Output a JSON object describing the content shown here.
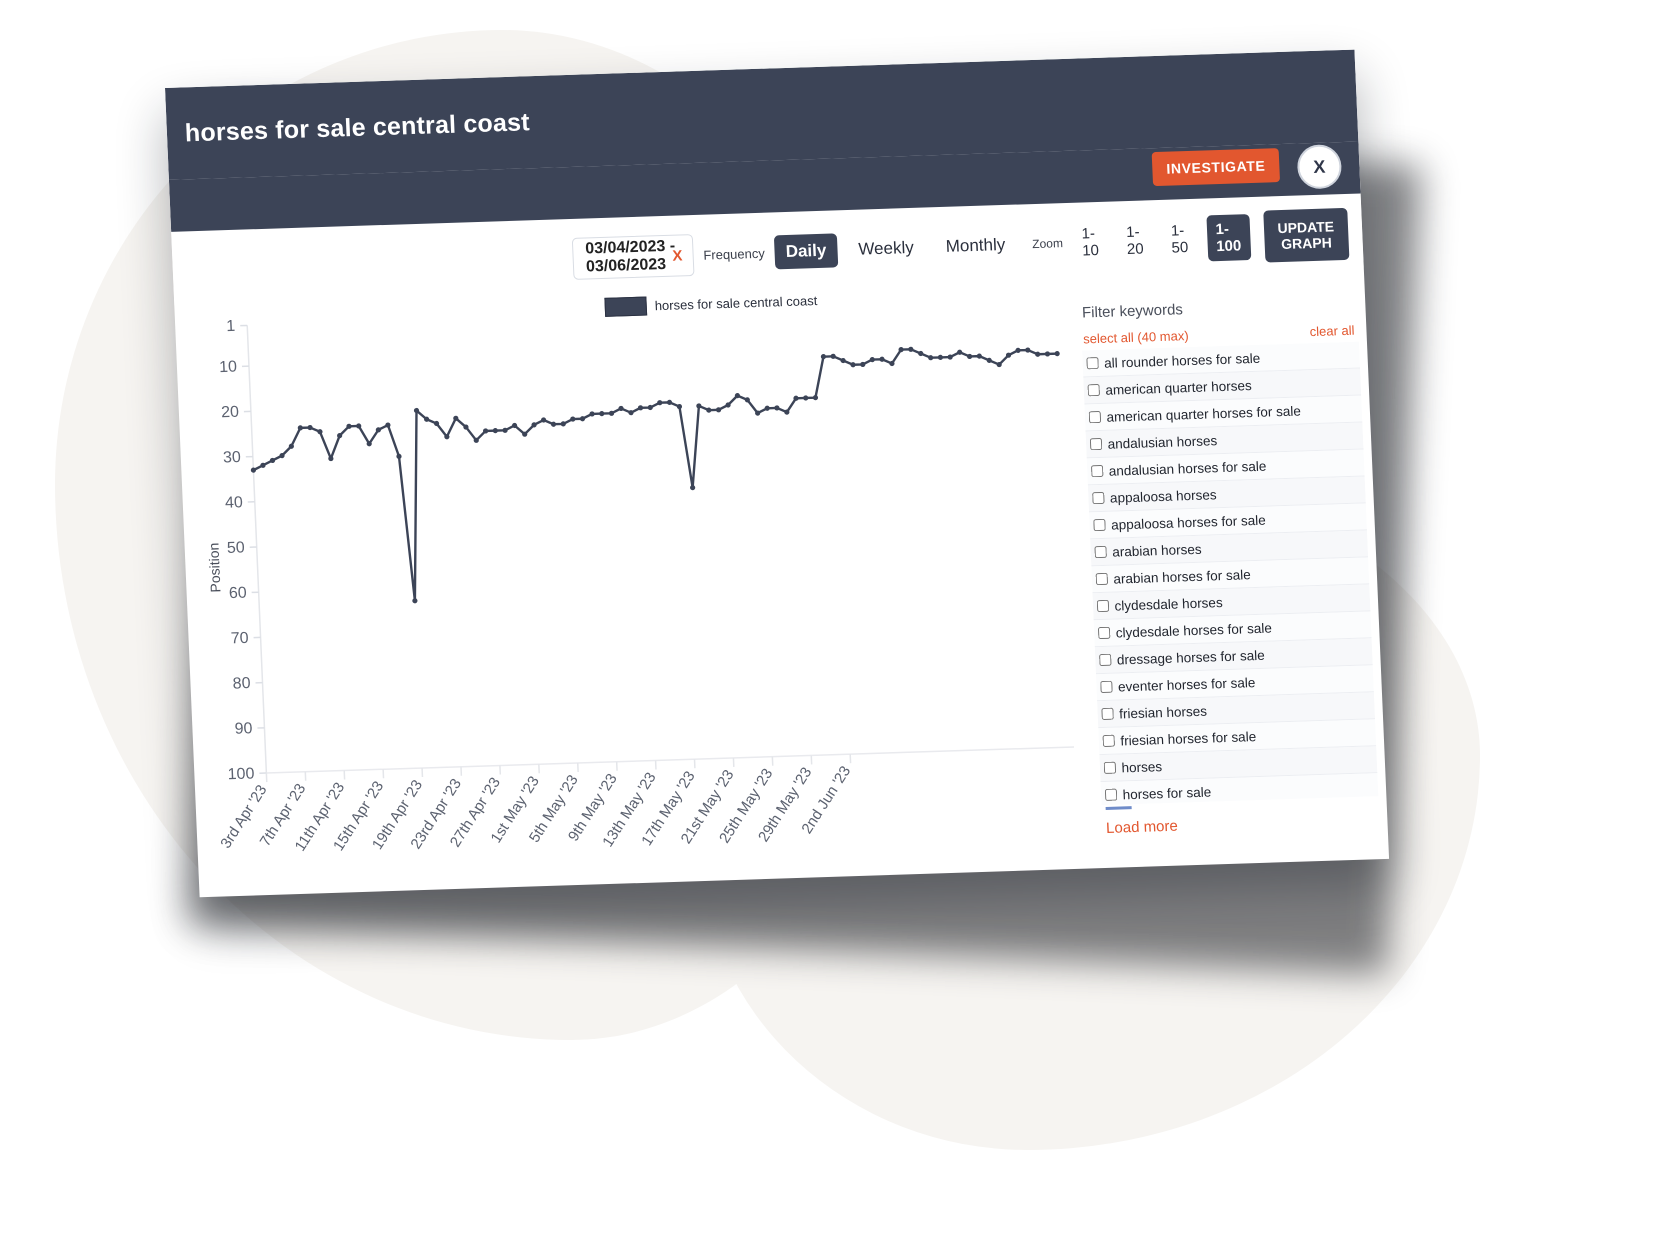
{
  "window": {
    "title": "horses for sale central coast",
    "investigate_label": "INVESTIGATE",
    "close_label": "X"
  },
  "toolbar": {
    "date_range_value": "03/04/2023 - 03/06/2023",
    "date_range_clear": "X",
    "frequency_label": "Frequency",
    "frequency_options": [
      {
        "label": "Daily",
        "selected": true
      },
      {
        "label": "Weekly",
        "selected": false
      },
      {
        "label": "Monthly",
        "selected": false
      }
    ],
    "zoom_label": "Zoom",
    "zoom_options": [
      {
        "label": "1-10",
        "selected": false
      },
      {
        "label": "1-20",
        "selected": false
      },
      {
        "label": "1-50",
        "selected": false
      },
      {
        "label": "1-100",
        "selected": true
      }
    ],
    "update_label": "UPDATE GRAPH"
  },
  "filter_panel": {
    "heading": "Filter keywords",
    "select_all": "select all (40 max)",
    "clear_all": "clear all",
    "load_more": "Load more",
    "keywords": [
      "all rounder horses for sale",
      "american quarter horses",
      "american quarter horses for sale",
      "andalusian horses",
      "andalusian horses for sale",
      "appaloosa horses",
      "appaloosa horses for sale",
      "arabian horses",
      "arabian horses for sale",
      "clydesdale horses",
      "clydesdale horses for sale",
      "dressage horses for sale",
      "eventer horses for sale",
      "friesian horses",
      "friesian horses for sale",
      "horses",
      "horses for sale"
    ]
  },
  "colors": {
    "accent": "#e2572f",
    "dark": "#3c4457",
    "line": "#3c4457"
  },
  "chart_data": {
    "type": "line",
    "title": "",
    "xlabel": "",
    "ylabel": "Position",
    "legend": [
      "horses for sale central coast"
    ],
    "legend_position": "top-center",
    "grid": false,
    "y_inverted": true,
    "ylim": [
      1,
      100
    ],
    "yticks": [
      1,
      10,
      20,
      30,
      40,
      50,
      60,
      70,
      80,
      90,
      100
    ],
    "xticks": [
      "3rd Apr '23",
      "7th Apr '23",
      "11th Apr '23",
      "15th Apr '23",
      "19th Apr '23",
      "23rd Apr '23",
      "27th Apr '23",
      "1st May '23",
      "5th May '23",
      "9th May '23",
      "13th May '23",
      "17th May '23",
      "21st May '23",
      "25th May '23",
      "29th May '23",
      "2nd Jun '23"
    ],
    "series": [
      {
        "name": "horses for sale central coast",
        "values": [
          33,
          32,
          31,
          30,
          28,
          24,
          24,
          25,
          31,
          26,
          24,
          24,
          28,
          25,
          24,
          31,
          63,
          21,
          23,
          24,
          27,
          23,
          25,
          28,
          26,
          26,
          26,
          25,
          27,
          25,
          24,
          25,
          25,
          24,
          24,
          23,
          23,
          23,
          22,
          23,
          22,
          22,
          21,
          21,
          22,
          40,
          22,
          23,
          23,
          22,
          20,
          21,
          24,
          23,
          23,
          24,
          21,
          21,
          21,
          12,
          12,
          13,
          14,
          14,
          13,
          13,
          14,
          11,
          11,
          12,
          13,
          13,
          13,
          12,
          13,
          13,
          14,
          15,
          13,
          12,
          12,
          13,
          13,
          13
        ]
      }
    ]
  }
}
